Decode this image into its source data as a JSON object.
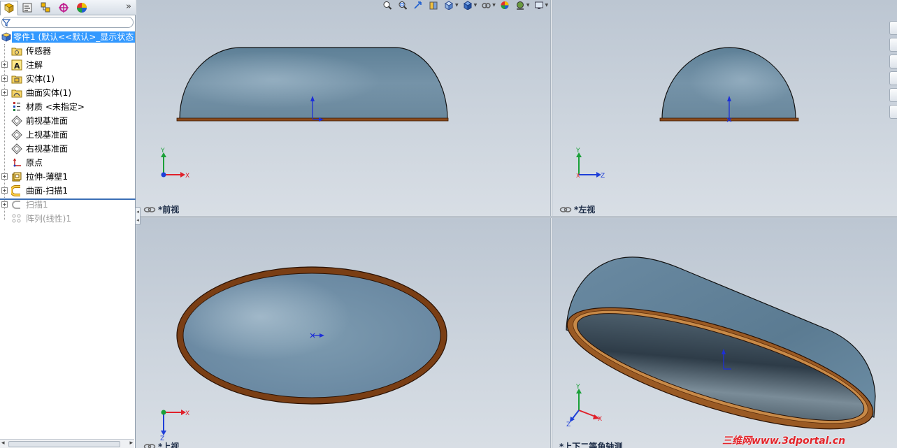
{
  "panel": {
    "tabs": [
      "feature-manager",
      "property-manager",
      "configuration-manager",
      "dimxpert-manager",
      "display-manager"
    ],
    "expand_glyph": "»"
  },
  "tree": {
    "root": "零件1  (默认<<默认>_显示状态",
    "items": [
      {
        "label": "传感器",
        "icon": "sensor-folder-icon",
        "expandable": false
      },
      {
        "label": "注解",
        "icon": "annotation-icon",
        "expandable": true
      },
      {
        "label": "实体(1)",
        "icon": "solid-bodies-icon",
        "expandable": true
      },
      {
        "label": "曲面实体(1)",
        "icon": "surface-bodies-icon",
        "expandable": true
      },
      {
        "label": "材质 <未指定>",
        "icon": "material-icon",
        "expandable": false
      },
      {
        "label": "前视基准面",
        "icon": "plane-icon",
        "expandable": false
      },
      {
        "label": "上视基准面",
        "icon": "plane-icon",
        "expandable": false
      },
      {
        "label": "右视基准面",
        "icon": "plane-icon",
        "expandable": false
      },
      {
        "label": "原点",
        "icon": "origin-icon",
        "expandable": false
      },
      {
        "label": "拉伸-薄壁1",
        "icon": "extrude-thin-icon",
        "expandable": true
      },
      {
        "label": "曲面-扫描1",
        "icon": "surface-sweep-icon",
        "expandable": true
      },
      {
        "label": "扫描1",
        "icon": "sweep-icon",
        "expandable": true,
        "suppressed": true
      },
      {
        "label": "阵列(线性)1",
        "icon": "linear-pattern-icon",
        "expandable": false,
        "suppressed": true
      }
    ]
  },
  "viewports": {
    "front": {
      "label": "*前视",
      "axes": [
        "Y",
        "X"
      ]
    },
    "left": {
      "label": "*左视",
      "axes": [
        "Y",
        "Z",
        "X"
      ]
    },
    "top": {
      "label": "*上视",
      "axes": [
        "X",
        "Z"
      ]
    },
    "iso": {
      "label": "*上下二等角轴测",
      "axes": [
        "Y",
        "X",
        "Z"
      ]
    }
  },
  "hud_buttons": [
    "zoom-to-fit-icon",
    "zoom-to-area-icon",
    "previous-view-icon",
    "section-view-icon",
    "view-orientation-icon",
    "display-style-icon",
    "hide-show-items-icon",
    "edit-appearance-icon",
    "apply-scene-icon",
    "view-settings-icon"
  ],
  "taskpane_buttons": [
    "solidworks-resources-icon",
    "design-library-icon",
    "file-explorer-icon",
    "view-palette-icon",
    "appearances-icon",
    "custom-properties-icon"
  ],
  "watermark": "三维网www.3dportal.cn",
  "colors": {
    "selection": "#3399ff",
    "part_fill": "#6d8fa6",
    "edge_copper": "#8a4a1c",
    "axis_x": "#e0202a",
    "axis_y": "#1aa038",
    "axis_z": "#1e3fd8",
    "watermark": "#e2242a"
  }
}
